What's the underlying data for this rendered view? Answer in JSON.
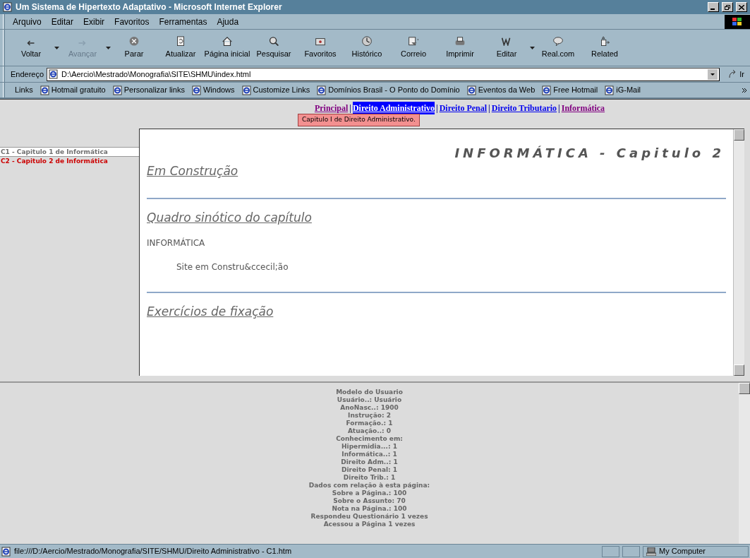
{
  "window": {
    "title": "Um Sistema de Hipertexto Adaptativo - Microsoft Internet Explorer"
  },
  "menu": [
    "Arquivo",
    "Editar",
    "Exibir",
    "Favoritos",
    "Ferramentas",
    "Ajuda"
  ],
  "toolbar": [
    {
      "kind": "back",
      "label": "Voltar",
      "disabled": false,
      "dropdown": true
    },
    {
      "kind": "forward",
      "label": "Avançar",
      "disabled": true,
      "dropdown": true
    },
    {
      "kind": "stop",
      "label": "Parar",
      "disabled": false,
      "dropdown": false
    },
    {
      "kind": "refresh",
      "label": "Atualizar",
      "disabled": false,
      "dropdown": false
    },
    {
      "kind": "home",
      "label": "Página inicial",
      "disabled": false,
      "dropdown": false
    },
    {
      "kind": "search",
      "label": "Pesquisar",
      "disabled": false,
      "dropdown": false
    },
    {
      "kind": "favorites",
      "label": "Favoritos",
      "disabled": false,
      "dropdown": false
    },
    {
      "kind": "history",
      "label": "Histórico",
      "disabled": false,
      "dropdown": false
    },
    {
      "kind": "mail",
      "label": "Correio",
      "disabled": false,
      "dropdown": false
    },
    {
      "kind": "print",
      "label": "Imprimir",
      "disabled": false,
      "dropdown": false
    },
    {
      "kind": "edit",
      "label": "Editar",
      "disabled": false,
      "dropdown": true
    },
    {
      "kind": "discuss",
      "label": "Real.com",
      "disabled": false,
      "dropdown": false
    },
    {
      "kind": "related",
      "label": "Related",
      "disabled": false,
      "dropdown": false
    }
  ],
  "address": {
    "label": "Endereço",
    "value": "D:\\Aercio\\Mestrado\\Monografia\\SITE\\SHMU\\index.html",
    "go": "Ir"
  },
  "links": {
    "label": "Links",
    "items": [
      "Hotmail gratuito",
      "Personalizar links",
      "Windows",
      "Customize Links",
      "Domínios Brasil - O Ponto do Domínio",
      "Eventos da Web",
      "Free Hotmail",
      "iG-Mail"
    ]
  },
  "nav": [
    {
      "label": "Principal",
      "visited": true,
      "selected": false
    },
    {
      "separator": "|",
      "label": "Direito Administrativo",
      "visited": false,
      "selected": true
    },
    {
      "separator": "|",
      "label": "Direito Penal",
      "visited": false,
      "selected": false
    },
    {
      "separator": "|",
      "label": "Direito Tributario",
      "visited": false,
      "selected": false
    },
    {
      "separator": "|",
      "label": "Informática",
      "visited": true,
      "selected": false
    }
  ],
  "tooltip": "Capitulo I de Direito Administrativo.",
  "chapters": [
    {
      "label": "C1 - Capitulo 1 de Informática",
      "selected": false
    },
    {
      "label": "C2 - Capitulo 2 de Informática",
      "selected": true
    }
  ],
  "content": {
    "title": "INFORMÁTICA - Capitulo 2",
    "sections": [
      {
        "heading": "Em Construção"
      },
      {
        "heading": "Quadro sinótico do capítulo",
        "lines": [
          "INFORMÁTICA",
          "Site em Constru&ccecil;ão"
        ]
      },
      {
        "heading": "Exercícios de fixação"
      }
    ]
  },
  "user_model": [
    "Modelo do Usuario",
    "Usuário..: Usuário",
    "AnoNasc..: 1900",
    "Instrução: 2",
    "Formação.: 1",
    "Atuação..: 0",
    "Conhecimento em:",
    "Hipermidia...: 1",
    "Informática..: 1",
    "Direito Adm..: 1",
    "Direito Penal: 1",
    "Direito Trib.: 1",
    "Dados com relação à esta página:",
    "Sobre a Página.: 100",
    "Sobre o Assunto: 70",
    "Nota na Página.: 100",
    "Respondeu Questionário 1 vezes",
    "Acessou a Página 1 vezes"
  ],
  "status_bar": {
    "text": "file:///D:/Aercio/Mestrado/Monografia/SITE/SHMU/Direito Administrativo - C1.htm",
    "zone": "My Computer"
  }
}
